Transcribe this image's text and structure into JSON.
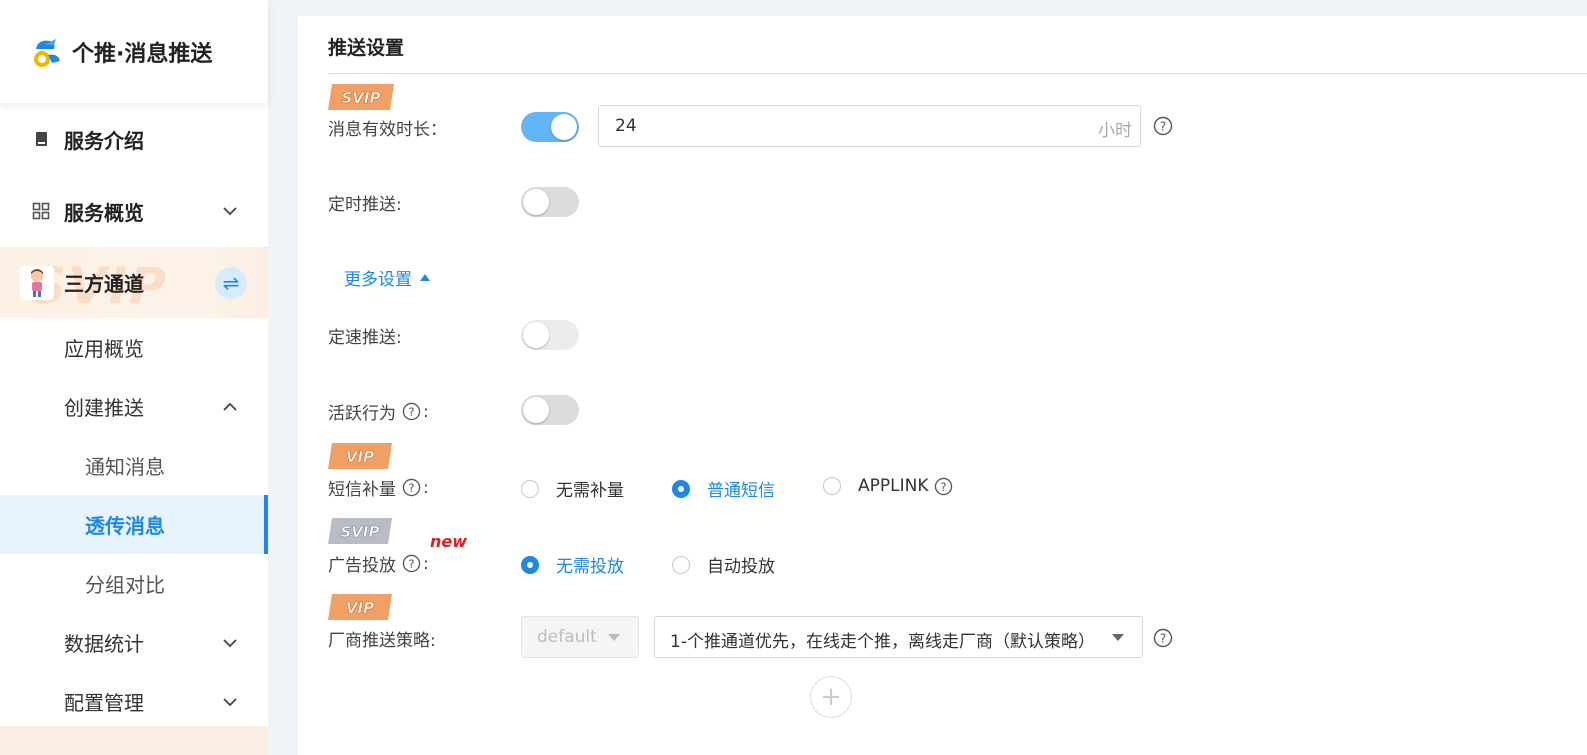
{
  "app": {
    "title": "个推·消息推送"
  },
  "sidebar": {
    "service_intro": "服务介绍",
    "service_overview": "服务概览",
    "third_party": "三方通道",
    "third_party_watermark": "SVIP",
    "app_overview": "应用概览",
    "create_push": "创建推送",
    "notify_msg": "通知消息",
    "passthrough_msg": "透传消息",
    "group_compare": "分组对比",
    "data_stats": "数据统计",
    "config_mgmt": "配置管理"
  },
  "main": {
    "section_title": "推送设置",
    "badges": {
      "svip": "SVIP",
      "vip": "VIP"
    },
    "msg_valid": {
      "label": "消息有效时长：",
      "value": "24",
      "unit": "小时",
      "enabled": true
    },
    "scheduled": {
      "label": "定时推送:",
      "enabled": false
    },
    "more_settings": "更多设置",
    "rate_push": {
      "label": "定速推送:",
      "enabled": false
    },
    "active_behavior": {
      "label": "活跃行为",
      "colon": ":",
      "enabled": false
    },
    "sms": {
      "label": "短信补量",
      "colon": ":",
      "options": [
        "无需补量",
        "普通短信",
        "APPLINK"
      ],
      "selected": "普通短信"
    },
    "ads": {
      "label": "广告投放",
      "colon": ":",
      "new_tag": "new",
      "options": [
        "无需投放",
        "自动投放"
      ],
      "selected": "无需投放"
    },
    "vendor": {
      "label": "厂商推送策略:",
      "select_a": "default",
      "select_b": "1-个推通道优先，在线走个推，离线走厂商（默认策略）"
    },
    "add_symbol": "+"
  },
  "colors": {
    "accent": "#1e88e5",
    "toggle_on": "#64b5f6",
    "svip_orange": "#f0a064",
    "svip_gray": "#b8bcc4",
    "new_red": "#e02020"
  }
}
